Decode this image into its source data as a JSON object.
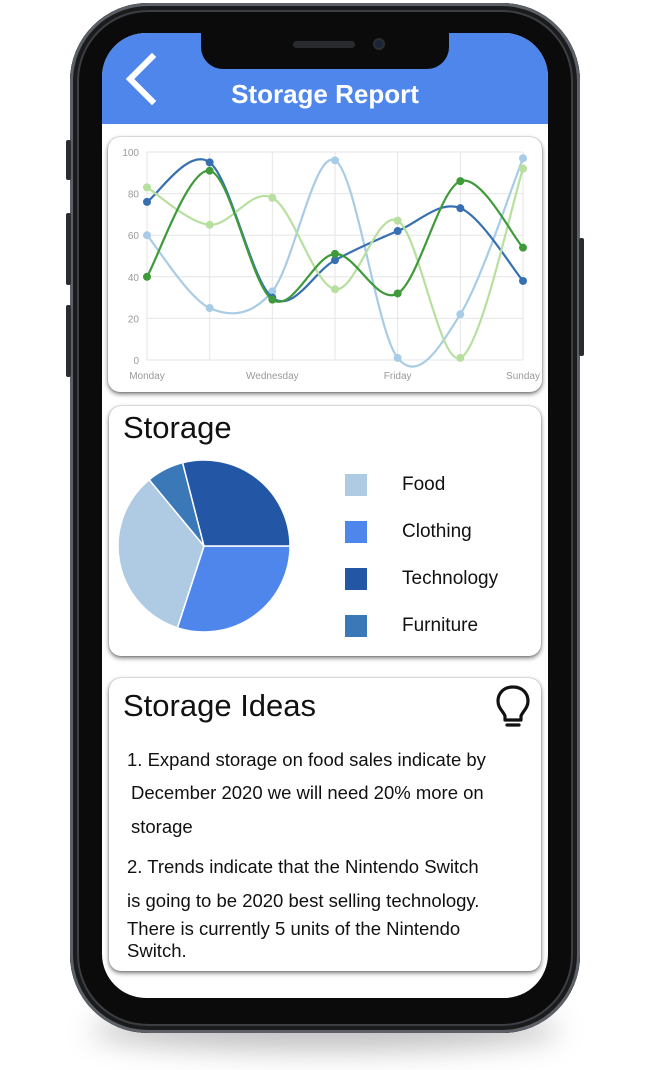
{
  "header": {
    "title": "Storage Report",
    "background_color": "#4f86ec",
    "back_icon": "chevron-left-icon"
  },
  "chart_data": {
    "type": "line",
    "smooth": true,
    "x": [
      "Monday",
      "",
      "Wednesday",
      "",
      "Friday",
      "",
      "Sunday"
    ],
    "x_tick_labels": [
      "Monday",
      "Wednesday",
      "Friday",
      "Sunday"
    ],
    "y_ticks": [
      "0",
      "20",
      "40",
      "60",
      "80",
      "100"
    ],
    "ylim": [
      0,
      100
    ],
    "grid": true,
    "series": [
      {
        "color": "#a9cce6",
        "values": [
          60,
          25,
          33,
          96,
          1,
          22,
          97
        ]
      },
      {
        "color": "#3670b2",
        "values": [
          76,
          95,
          30,
          48,
          62,
          73,
          38
        ]
      },
      {
        "color": "#b7e0a0",
        "values": [
          83,
          65,
          78,
          34,
          67,
          1,
          92
        ]
      },
      {
        "color": "#3f9a3a",
        "values": [
          40,
          91,
          29,
          51,
          32,
          86,
          54
        ]
      }
    ]
  },
  "storage": {
    "title": "Storage",
    "pie": {
      "type": "pie",
      "slices": [
        {
          "label": "Food",
          "value": 34,
          "color": "#aecbe3"
        },
        {
          "label": "Clothing",
          "value": 30,
          "color": "#4f86ec"
        },
        {
          "label": "Technology",
          "value": 29,
          "color": "#2357a6"
        },
        {
          "label": "Furniture",
          "value": 7,
          "color": "#3b78b8"
        }
      ]
    },
    "legend": [
      {
        "label": "Food",
        "color": "#aecbe3"
      },
      {
        "label": "Clothing",
        "color": "#4f86ec"
      },
      {
        "label": "Technology",
        "color": "#2357a6"
      },
      {
        "label": "Furniture",
        "color": "#3b78b8"
      }
    ]
  },
  "ideas": {
    "title": "Storage Ideas",
    "icon": "lightbulb-icon",
    "idea1_lines": [
      "1. Expand storage on food  sales indicate by",
      "December 2020 we will need 20% more on",
      "storage"
    ],
    "idea2_lines": [
      "2. Trends indicate that the Nintendo Switch",
      "is going to be 2020 best selling technology.",
      "There is currently 5 units of the Nintendo",
      "Switch."
    ]
  }
}
